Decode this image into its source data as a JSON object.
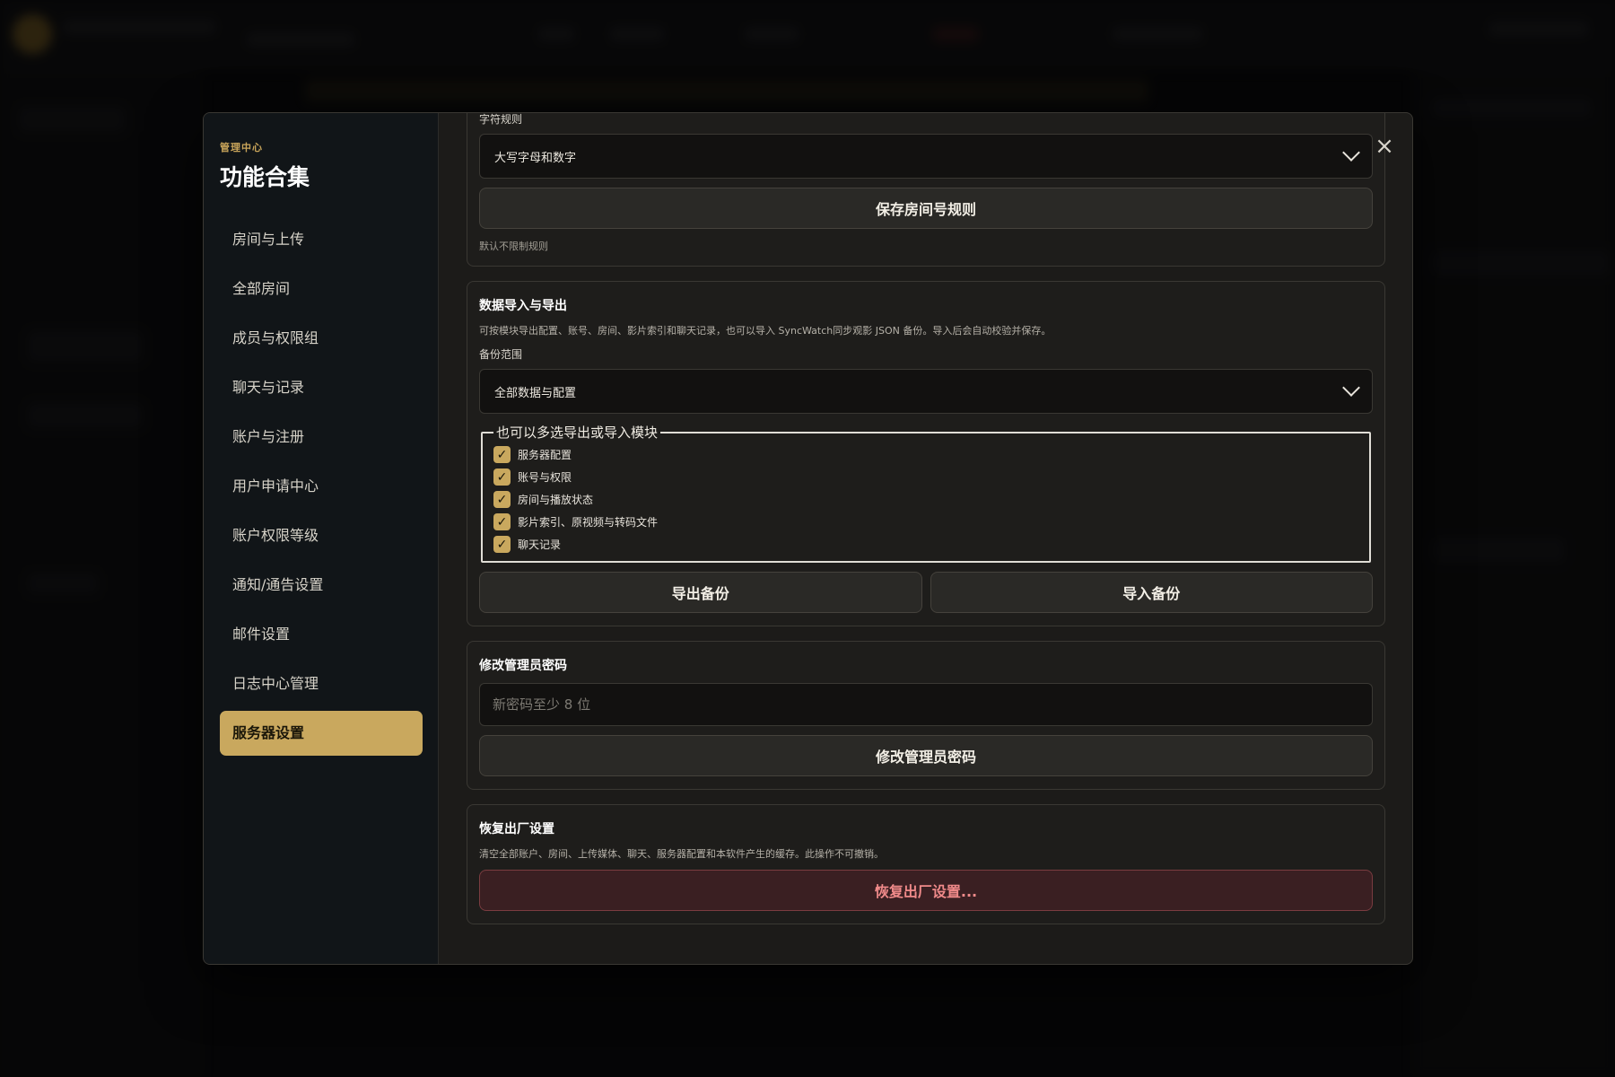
{
  "sidebar": {
    "eyebrow": "管理中心",
    "title": "功能合集",
    "items": [
      {
        "label": "房间与上传"
      },
      {
        "label": "全部房间"
      },
      {
        "label": "成员与权限组"
      },
      {
        "label": "聊天与记录"
      },
      {
        "label": "账户与注册"
      },
      {
        "label": "用户申请中心"
      },
      {
        "label": "账户权限等级"
      },
      {
        "label": "通知/通告设置"
      },
      {
        "label": "邮件设置"
      },
      {
        "label": "日志中心管理"
      },
      {
        "label": "服务器设置",
        "active": true
      }
    ]
  },
  "close_icon": "close-icon",
  "room_rule": {
    "field_label": "字符规则",
    "select_value": "大写字母和数字",
    "save_label": "保存房间号规则",
    "hint": "默认不限制规则"
  },
  "data_io": {
    "title": "数据导入与导出",
    "desc": "可按模块导出配置、账号、房间、影片索引和聊天记录，也可以导入 SyncWatch同步观影 JSON 备份。导入后会自动校验并保存。",
    "scope_label": "备份范围",
    "scope_value": "全部数据与配置",
    "modules_legend": "也可以多选导出或导入模块",
    "modules": [
      {
        "label": "服务器配置",
        "checked": true
      },
      {
        "label": "账号与权限",
        "checked": true
      },
      {
        "label": "房间与播放状态",
        "checked": true
      },
      {
        "label": "影片索引、原视频与转码文件",
        "checked": true
      },
      {
        "label": "聊天记录",
        "checked": true
      }
    ],
    "export_label": "导出备份",
    "import_label": "导入备份"
  },
  "admin_password": {
    "title": "修改管理员密码",
    "placeholder": "新密码至少 8 位",
    "submit_label": "修改管理员密码"
  },
  "factory_reset": {
    "title": "恢复出厂设置",
    "desc": "清空全部账户、房间、上传媒体、聊天、服务器配置和本软件产生的缓存。此操作不可撤销。",
    "button_label": "恢复出厂设置..."
  },
  "colors": {
    "accent": "#c9a85e",
    "danger": "#f08a8a"
  }
}
